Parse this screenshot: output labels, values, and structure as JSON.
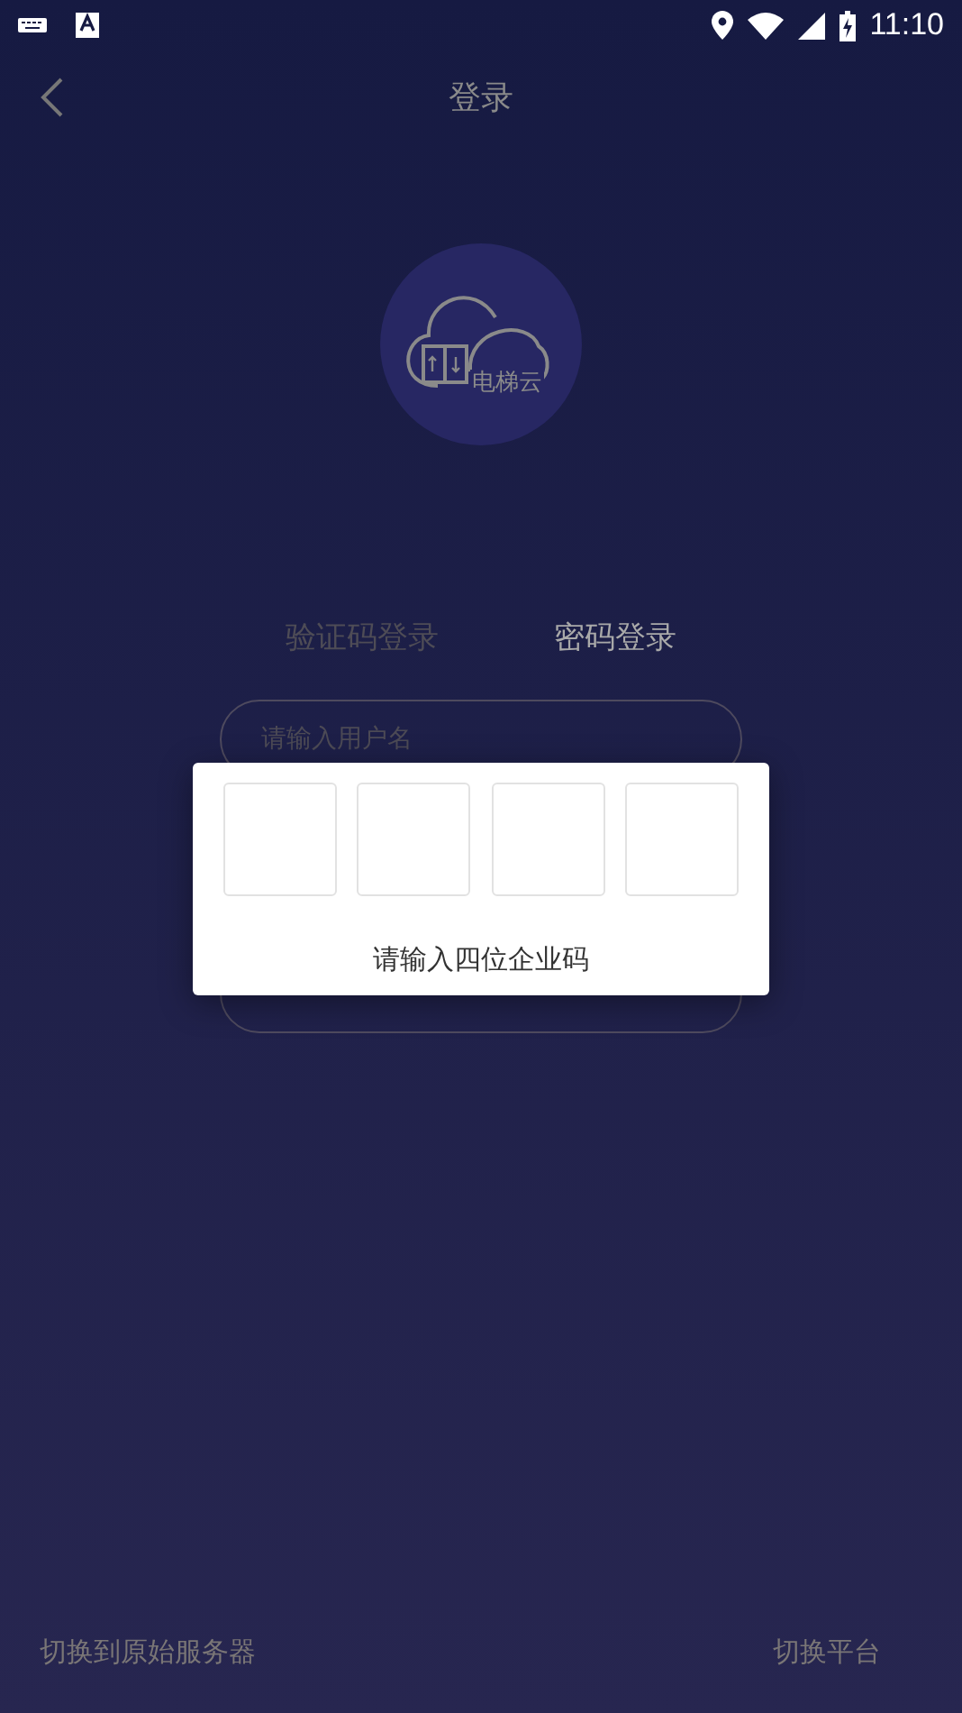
{
  "status_bar": {
    "time": "11:10"
  },
  "header": {
    "title": "登录"
  },
  "logo": {
    "caption": "电梯云"
  },
  "tabs": [
    {
      "label": "验证码登录",
      "selected": false
    },
    {
      "label": "密码登录",
      "selected": true
    }
  ],
  "username_field": {
    "placeholder": "请输入用户名"
  },
  "dialog": {
    "code_boxes": [
      {
        "kind": "digit"
      },
      {
        "kind": "digit"
      },
      {
        "kind": "digit"
      },
      {
        "kind": "digit"
      }
    ],
    "prompt": "请输入四位企业码"
  },
  "footer": {
    "left_link": "切换到原始服务器",
    "right_link": "切换平台"
  }
}
